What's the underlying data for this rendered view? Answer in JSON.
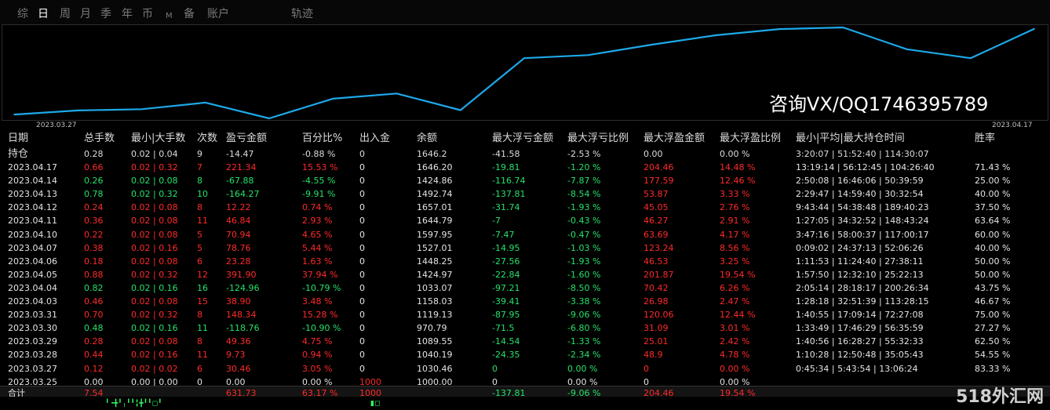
{
  "tabs": [
    "综",
    "日",
    "周",
    "月",
    "季",
    "年",
    "币",
    "M",
    "备",
    "账户",
    "轨迹"
  ],
  "active_tab": "日",
  "chart_data": {
    "type": "line",
    "x": [
      "2023.03.25",
      "2023.03.27",
      "2023.03.28",
      "2023.03.29",
      "2023.03.30",
      "2023.03.31",
      "2023.04.03",
      "2023.04.04",
      "2023.04.05",
      "2023.04.06",
      "2023.04.07",
      "2023.04.10",
      "2023.04.11",
      "2023.04.12",
      "2023.04.13",
      "2023.04.14",
      "2023.04.17"
    ],
    "series": [
      {
        "values": [
          1000.0,
          1030.46,
          1040.19,
          1089.55,
          970.79,
          1119.13,
          1158.03,
          1033.07,
          1424.97,
          1448.25,
          1527.01,
          1597.95,
          1644.79,
          1657.01,
          1492.74,
          1424.86,
          1646.2
        ]
      }
    ],
    "start_label": "2023.03.27",
    "end_label": "2023.04.17",
    "line_color": "#1ea8e8"
  },
  "watermark": "咨询VX/QQ1746395789",
  "headers": [
    "日期",
    "总手数",
    "最小|大手数",
    "次数",
    "盈亏金额",
    "百分比%",
    "出入金",
    "余额",
    "最大浮亏金额",
    "最大浮亏比例",
    "最大浮盈金额",
    "最大浮盈比例",
    "最小|平均|最大持仓时间",
    "胜率"
  ],
  "holding": {
    "date": "持仓",
    "lots": "0.28",
    "minmax": "0.02 | 0.04",
    "count": "9",
    "pl": "-14.47",
    "pct": "-0.88 %",
    "flow": "0",
    "bal": "1646.2",
    "maxloss": "-41.58",
    "maxlosspct": "-2.53 %",
    "maxprofit": "0.00",
    "maxprofitpct": "0.00 %",
    "time": "3:20:07 | 51:52:40 | 114:30:07",
    "win": ""
  },
  "rows": [
    {
      "date": "2023.04.17",
      "lots": "0.66",
      "minmax": "0.02 | 0.32",
      "count": "7",
      "pl": "221.34",
      "pct": "15.53 %",
      "flow": "0",
      "bal": "1646.20",
      "maxloss": "-19.81",
      "maxlosspct": "-1.20 %",
      "maxprofit": "204.46",
      "maxprofitpct": "14.48 %",
      "time": "13:19:14 | 56:12:45 | 104:26:40",
      "win": "71.43 %",
      "c": "r"
    },
    {
      "date": "2023.04.14",
      "lots": "0.26",
      "minmax": "0.02 | 0.08",
      "count": "8",
      "pl": "-67.88",
      "pct": "-4.55 %",
      "flow": "0",
      "bal": "1424.86",
      "maxloss": "-116.74",
      "maxlosspct": "-7.87 %",
      "maxprofit": "177.59",
      "maxprofitpct": "12.46 %",
      "time": "2:50:08 | 16:46:06 | 50:39:59",
      "win": "25.00 %",
      "c": "g"
    },
    {
      "date": "2023.04.13",
      "lots": "0.78",
      "minmax": "0.02 | 0.32",
      "count": "10",
      "pl": "-164.27",
      "pct": "-9.91 %",
      "flow": "0",
      "bal": "1492.74",
      "maxloss": "-137.81",
      "maxlosspct": "-8.54 %",
      "maxprofit": "53.87",
      "maxprofitpct": "3.33 %",
      "time": "2:29:47 | 14:59:40 | 30:32:54",
      "win": "40.00 %",
      "c": "g"
    },
    {
      "date": "2023.04.12",
      "lots": "0.24",
      "minmax": "0.02 | 0.08",
      "count": "8",
      "pl": "12.22",
      "pct": "0.74 %",
      "flow": "0",
      "bal": "1657.01",
      "maxloss": "-31.74",
      "maxlosspct": "-1.93 %",
      "maxprofit": "45.05",
      "maxprofitpct": "2.76 %",
      "time": "9:43:44 | 54:38:48 | 189:40:23",
      "win": "37.50 %",
      "c": "r"
    },
    {
      "date": "2023.04.11",
      "lots": "0.36",
      "minmax": "0.02 | 0.08",
      "count": "11",
      "pl": "46.84",
      "pct": "2.93 %",
      "flow": "0",
      "bal": "1644.79",
      "maxloss": "-7",
      "maxlosspct": "-0.43 %",
      "maxprofit": "46.27",
      "maxprofitpct": "2.91 %",
      "time": "1:27:05 | 34:32:52 | 148:43:24",
      "win": "63.64 %",
      "c": "r"
    },
    {
      "date": "2023.04.10",
      "lots": "0.22",
      "minmax": "0.02 | 0.08",
      "count": "5",
      "pl": "70.94",
      "pct": "4.65 %",
      "flow": "0",
      "bal": "1597.95",
      "maxloss": "-7.47",
      "maxlosspct": "-0.47 %",
      "maxprofit": "63.69",
      "maxprofitpct": "4.17 %",
      "time": "3:47:16 | 58:00:37 | 117:00:17",
      "win": "60.00 %",
      "c": "r"
    },
    {
      "date": "2023.04.07",
      "lots": "0.38",
      "minmax": "0.02 | 0.16",
      "count": "5",
      "pl": "78.76",
      "pct": "5.44 %",
      "flow": "0",
      "bal": "1527.01",
      "maxloss": "-14.95",
      "maxlosspct": "-1.03 %",
      "maxprofit": "123.24",
      "maxprofitpct": "8.56 %",
      "time": "0:09:02 | 24:37:13 | 52:06:26",
      "win": "40.00 %",
      "c": "r"
    },
    {
      "date": "2023.04.06",
      "lots": "0.18",
      "minmax": "0.02 | 0.08",
      "count": "6",
      "pl": "23.28",
      "pct": "1.63 %",
      "flow": "0",
      "bal": "1448.25",
      "maxloss": "-27.56",
      "maxlosspct": "-1.93 %",
      "maxprofit": "46.53",
      "maxprofitpct": "3.25 %",
      "time": "1:11:53 | 11:24:40 | 27:38:11",
      "win": "50.00 %",
      "c": "r"
    },
    {
      "date": "2023.04.05",
      "lots": "0.88",
      "minmax": "0.02 | 0.32",
      "count": "12",
      "pl": "391.90",
      "pct": "37.94 %",
      "flow": "0",
      "bal": "1424.97",
      "maxloss": "-22.84",
      "maxlosspct": "-1.60 %",
      "maxprofit": "201.87",
      "maxprofitpct": "19.54 %",
      "time": "1:57:50 | 12:32:10 | 25:22:13",
      "win": "50.00 %",
      "c": "r"
    },
    {
      "date": "2023.04.04",
      "lots": "0.82",
      "minmax": "0.02 | 0.16",
      "count": "16",
      "pl": "-124.96",
      "pct": "-10.79 %",
      "flow": "0",
      "bal": "1033.07",
      "maxloss": "-97.21",
      "maxlosspct": "-8.50 %",
      "maxprofit": "70.42",
      "maxprofitpct": "6.26 %",
      "time": "2:05:14 | 28:18:17 | 200:26:34",
      "win": "43.75 %",
      "c": "g"
    },
    {
      "date": "2023.04.03",
      "lots": "0.46",
      "minmax": "0.02 | 0.08",
      "count": "15",
      "pl": "38.90",
      "pct": "3.48 %",
      "flow": "0",
      "bal": "1158.03",
      "maxloss": "-39.41",
      "maxlosspct": "-3.38 %",
      "maxprofit": "26.98",
      "maxprofitpct": "2.47 %",
      "time": "1:28:18 | 32:51:39 | 113:28:15",
      "win": "46.67 %",
      "c": "r"
    },
    {
      "date": "2023.03.31",
      "lots": "0.70",
      "minmax": "0.02 | 0.32",
      "count": "8",
      "pl": "148.34",
      "pct": "15.28 %",
      "flow": "0",
      "bal": "1119.13",
      "maxloss": "-87.95",
      "maxlosspct": "-9.06 %",
      "maxprofit": "120.06",
      "maxprofitpct": "12.44 %",
      "time": "1:40:55 | 17:09:14 | 72:27:08",
      "win": "75.00 %",
      "c": "r"
    },
    {
      "date": "2023.03.30",
      "lots": "0.48",
      "minmax": "0.02 | 0.16",
      "count": "11",
      "pl": "-118.76",
      "pct": "-10.90 %",
      "flow": "0",
      "bal": "970.79",
      "maxloss": "-71.5",
      "maxlosspct": "-6.80 %",
      "maxprofit": "31.09",
      "maxprofitpct": "3.01 %",
      "time": "1:33:49 | 17:46:29 | 56:35:59",
      "win": "27.27 %",
      "c": "g"
    },
    {
      "date": "2023.03.29",
      "lots": "0.28",
      "minmax": "0.02 | 0.08",
      "count": "8",
      "pl": "49.36",
      "pct": "4.75 %",
      "flow": "0",
      "bal": "1089.55",
      "maxloss": "-14.54",
      "maxlosspct": "-1.33 %",
      "maxprofit": "25.01",
      "maxprofitpct": "2.42 %",
      "time": "1:40:56 | 16:28:27 | 55:32:33",
      "win": "62.50 %",
      "c": "r"
    },
    {
      "date": "2023.03.28",
      "lots": "0.44",
      "minmax": "0.02 | 0.16",
      "count": "11",
      "pl": "9.73",
      "pct": "0.94 %",
      "flow": "0",
      "bal": "1040.19",
      "maxloss": "-24.35",
      "maxlosspct": "-2.34 %",
      "maxprofit": "48.9",
      "maxprofitpct": "4.78 %",
      "time": "1:10:28 | 12:50:48 | 35:05:43",
      "win": "54.55 %",
      "c": "r"
    },
    {
      "date": "2023.03.27",
      "lots": "0.12",
      "minmax": "0.02 | 0.02",
      "count": "6",
      "pl": "30.46",
      "pct": "3.05 %",
      "flow": "0",
      "bal": "1030.46",
      "maxloss": "0",
      "maxlosspct": "0.00 %",
      "maxprofit": "0",
      "maxprofitpct": "0.00 %",
      "time": "0:45:34 | 5:43:54 | 13:06:24",
      "win": "83.33 %",
      "c": "r"
    },
    {
      "date": "2023.03.25",
      "lots": "0.00",
      "minmax": "0.00 | 0.00",
      "count": "0",
      "pl": "0.00",
      "pct": "0.00 %",
      "flow": "1000",
      "bal": "1000.00",
      "maxloss": "0",
      "maxlosspct": "0.00 %",
      "maxprofit": "0",
      "maxprofitpct": "0.00 %",
      "time": "",
      "win": "",
      "c": "w"
    }
  ],
  "total": {
    "date": "合计",
    "lots": "7.54",
    "pl": "631.73",
    "pct": "63.17 %",
    "flow": "1000",
    "maxloss": "-137.81",
    "maxlosspct": "-9.06 %",
    "maxprofit": "204.46",
    "maxprofitpct": "19.54 %"
  },
  "brand": "518外汇网"
}
